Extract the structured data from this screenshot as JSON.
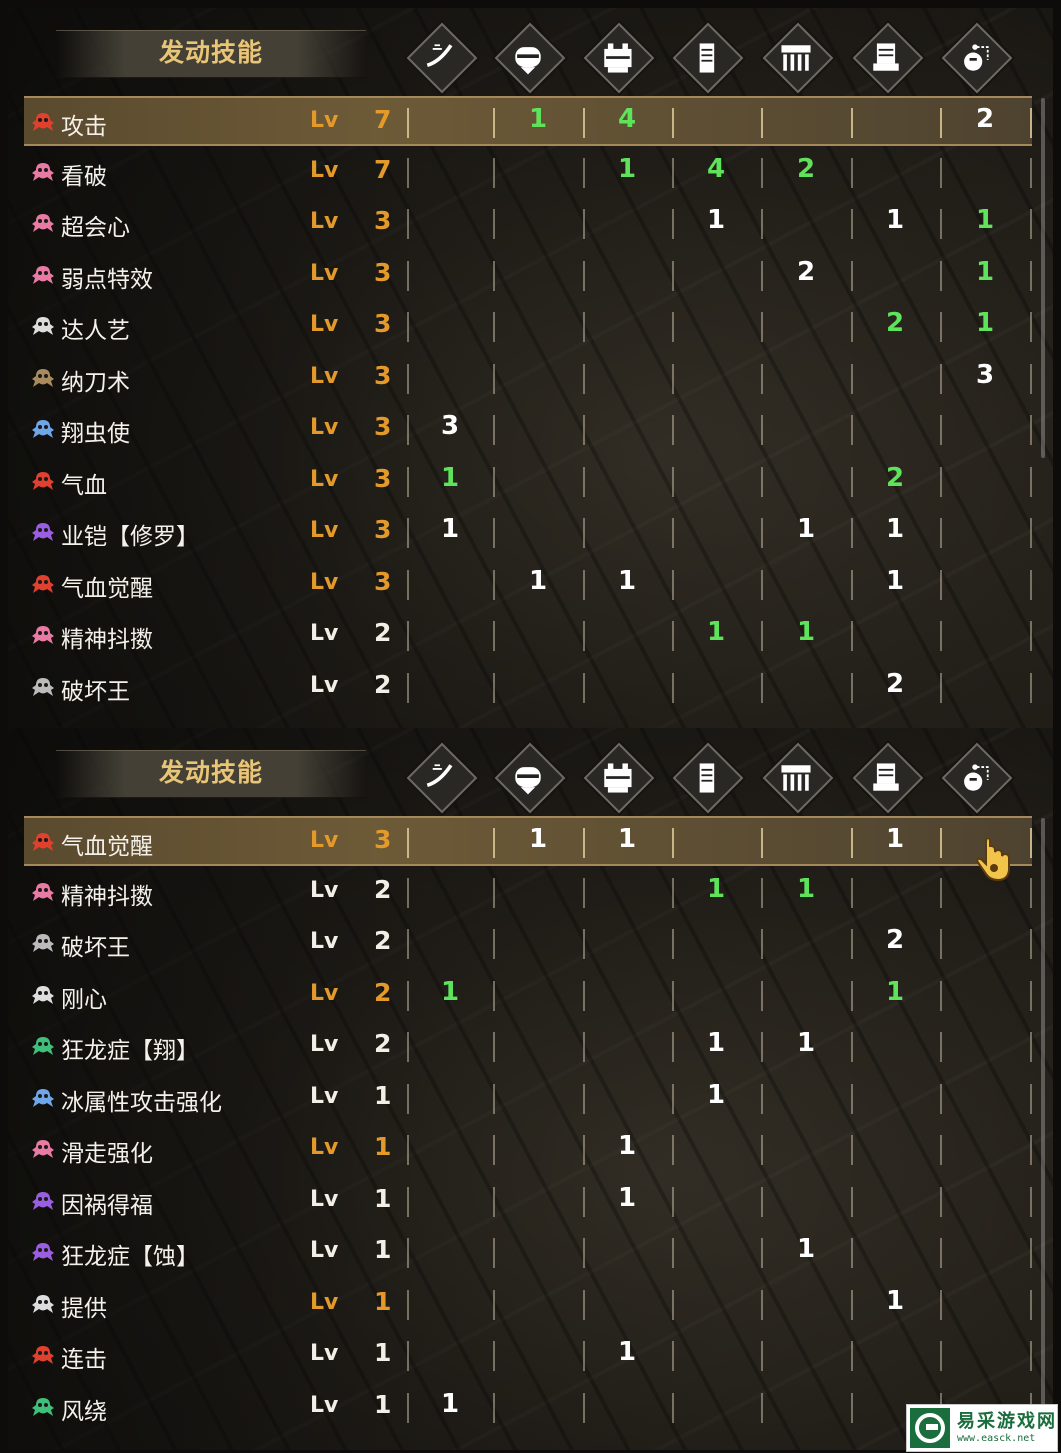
{
  "columns": [
    {
      "icon": "weapon-icon"
    },
    {
      "icon": "helm-icon"
    },
    {
      "icon": "chest-icon"
    },
    {
      "icon": "arms-icon"
    },
    {
      "icon": "waist-icon"
    },
    {
      "icon": "legs-icon"
    },
    {
      "icon": "talisman-icon"
    }
  ],
  "panels": [
    {
      "title": "发动技能",
      "selected_index": 0,
      "rows": [
        {
          "name": "攻击",
          "lv_label": "Lv",
          "level": "7",
          "maxed": true,
          "color": "#e0402e",
          "values": [
            "",
            "1",
            "4",
            "",
            "",
            "",
            "2"
          ],
          "greens": [
            false,
            true,
            true,
            false,
            false,
            false,
            false
          ]
        },
        {
          "name": "看破",
          "lv_label": "Lv",
          "level": "7",
          "maxed": true,
          "color": "#e87aa4",
          "values": [
            "",
            "",
            "1",
            "4",
            "2",
            "",
            ""
          ],
          "greens": [
            false,
            false,
            true,
            true,
            true,
            false,
            false
          ]
        },
        {
          "name": "超会心",
          "lv_label": "Lv",
          "level": "3",
          "maxed": true,
          "color": "#e87aa4",
          "values": [
            "",
            "",
            "",
            "1",
            "",
            "1",
            "1"
          ],
          "greens": [
            false,
            false,
            false,
            false,
            false,
            false,
            true
          ]
        },
        {
          "name": "弱点特效",
          "lv_label": "Lv",
          "level": "3",
          "maxed": true,
          "color": "#e87aa4",
          "values": [
            "",
            "",
            "",
            "",
            "2",
            "",
            "1"
          ],
          "greens": [
            false,
            false,
            false,
            false,
            false,
            false,
            true
          ]
        },
        {
          "name": "达人艺",
          "lv_label": "Lv",
          "level": "3",
          "maxed": true,
          "color": "#dddddd",
          "values": [
            "",
            "",
            "",
            "",
            "",
            "2",
            "1"
          ],
          "greens": [
            false,
            false,
            false,
            false,
            false,
            true,
            true
          ]
        },
        {
          "name": "纳刀术",
          "lv_label": "Lv",
          "level": "3",
          "maxed": true,
          "color": "#a88a5e",
          "values": [
            "",
            "",
            "",
            "",
            "",
            "",
            "3"
          ],
          "greens": [
            false,
            false,
            false,
            false,
            false,
            false,
            false
          ]
        },
        {
          "name": "翔虫使",
          "lv_label": "Lv",
          "level": "3",
          "maxed": true,
          "color": "#6fa6e8",
          "values": [
            "3",
            "",
            "",
            "",
            "",
            "",
            ""
          ],
          "greens": [
            false,
            false,
            false,
            false,
            false,
            false,
            false
          ]
        },
        {
          "name": "气血",
          "lv_label": "Lv",
          "level": "3",
          "maxed": true,
          "color": "#e0402e",
          "values": [
            "1",
            "",
            "",
            "",
            "",
            "2",
            ""
          ],
          "greens": [
            true,
            false,
            false,
            false,
            false,
            true,
            false
          ]
        },
        {
          "name": "业铠【修罗】",
          "lv_label": "Lv",
          "level": "3",
          "maxed": true,
          "color": "#9a5ee0",
          "values": [
            "1",
            "",
            "",
            "",
            "1",
            "1",
            ""
          ],
          "greens": [
            false,
            false,
            false,
            false,
            false,
            false,
            false
          ]
        },
        {
          "name": "气血觉醒",
          "lv_label": "Lv",
          "level": "3",
          "maxed": true,
          "color": "#e0402e",
          "values": [
            "",
            "1",
            "1",
            "",
            "",
            "1",
            ""
          ],
          "greens": [
            false,
            false,
            false,
            false,
            false,
            false,
            false
          ]
        },
        {
          "name": "精神抖擞",
          "lv_label": "Lv",
          "level": "2",
          "maxed": false,
          "color": "#e87aa4",
          "values": [
            "",
            "",
            "",
            "1",
            "1",
            "",
            ""
          ],
          "greens": [
            false,
            false,
            false,
            true,
            true,
            false,
            false
          ]
        },
        {
          "name": "破坏王",
          "lv_label": "Lv",
          "level": "2",
          "maxed": false,
          "color": "#bbbbbb",
          "values": [
            "",
            "",
            "",
            "",
            "",
            "2",
            ""
          ],
          "greens": [
            false,
            false,
            false,
            false,
            false,
            false,
            false
          ]
        }
      ]
    },
    {
      "title": "发动技能",
      "selected_index": 0,
      "rows": [
        {
          "name": "气血觉醒",
          "lv_label": "Lv",
          "level": "3",
          "maxed": true,
          "color": "#e0402e",
          "values": [
            "",
            "1",
            "1",
            "",
            "",
            "1",
            ""
          ],
          "greens": [
            false,
            false,
            false,
            false,
            false,
            false,
            false
          ]
        },
        {
          "name": "精神抖擞",
          "lv_label": "Lv",
          "level": "2",
          "maxed": false,
          "color": "#e87aa4",
          "values": [
            "",
            "",
            "",
            "1",
            "1",
            "",
            ""
          ],
          "greens": [
            false,
            false,
            false,
            true,
            true,
            false,
            false
          ]
        },
        {
          "name": "破坏王",
          "lv_label": "Lv",
          "level": "2",
          "maxed": false,
          "color": "#bbbbbb",
          "values": [
            "",
            "",
            "",
            "",
            "",
            "2",
            ""
          ],
          "greens": [
            false,
            false,
            false,
            false,
            false,
            false,
            false
          ]
        },
        {
          "name": "刚心",
          "lv_label": "Lv",
          "level": "2",
          "maxed": true,
          "color": "#dddddd",
          "values": [
            "1",
            "",
            "",
            "",
            "",
            "1",
            ""
          ],
          "greens": [
            true,
            false,
            false,
            false,
            false,
            true,
            false
          ]
        },
        {
          "name": "狂龙症【翔】",
          "lv_label": "Lv",
          "level": "2",
          "maxed": false,
          "color": "#3fbf7a",
          "values": [
            "",
            "",
            "",
            "1",
            "1",
            "",
            ""
          ],
          "greens": [
            false,
            false,
            false,
            false,
            false,
            false,
            false
          ]
        },
        {
          "name": "冰属性攻击强化",
          "lv_label": "Lv",
          "level": "1",
          "maxed": false,
          "color": "#6fa6e8",
          "values": [
            "",
            "",
            "",
            "1",
            "",
            "",
            ""
          ],
          "greens": [
            false,
            false,
            false,
            false,
            false,
            false,
            false
          ]
        },
        {
          "name": "滑走强化",
          "lv_label": "Lv",
          "level": "1",
          "maxed": true,
          "color": "#e87aa4",
          "values": [
            "",
            "",
            "1",
            "",
            "",
            "",
            ""
          ],
          "greens": [
            false,
            false,
            false,
            false,
            false,
            false,
            false
          ]
        },
        {
          "name": "因祸得福",
          "lv_label": "Lv",
          "level": "1",
          "maxed": false,
          "color": "#9a5ee0",
          "values": [
            "",
            "",
            "1",
            "",
            "",
            "",
            ""
          ],
          "greens": [
            false,
            false,
            false,
            false,
            false,
            false,
            false
          ]
        },
        {
          "name": "狂龙症【蚀】",
          "lv_label": "Lv",
          "level": "1",
          "maxed": false,
          "color": "#9a5ee0",
          "values": [
            "",
            "",
            "",
            "",
            "1",
            "",
            ""
          ],
          "greens": [
            false,
            false,
            false,
            false,
            false,
            false,
            false
          ]
        },
        {
          "name": "提供",
          "lv_label": "Lv",
          "level": "1",
          "maxed": true,
          "color": "#dddddd",
          "values": [
            "",
            "",
            "",
            "",
            "",
            "1",
            ""
          ],
          "greens": [
            false,
            false,
            false,
            false,
            false,
            false,
            false
          ]
        },
        {
          "name": "连击",
          "lv_label": "Lv",
          "level": "1",
          "maxed": false,
          "color": "#e0402e",
          "values": [
            "",
            "",
            "1",
            "",
            "",
            "",
            ""
          ],
          "greens": [
            false,
            false,
            false,
            false,
            false,
            false,
            false
          ]
        },
        {
          "name": "风绕",
          "lv_label": "Lv",
          "level": "1",
          "maxed": false,
          "color": "#3fbf7a",
          "values": [
            "1",
            "",
            "",
            "",
            "",
            "",
            ""
          ],
          "greens": [
            false,
            false,
            false,
            false,
            false,
            false,
            false
          ]
        }
      ]
    }
  ],
  "watermark": {
    "text": "易采游戏网",
    "url": "www.easck.net"
  }
}
